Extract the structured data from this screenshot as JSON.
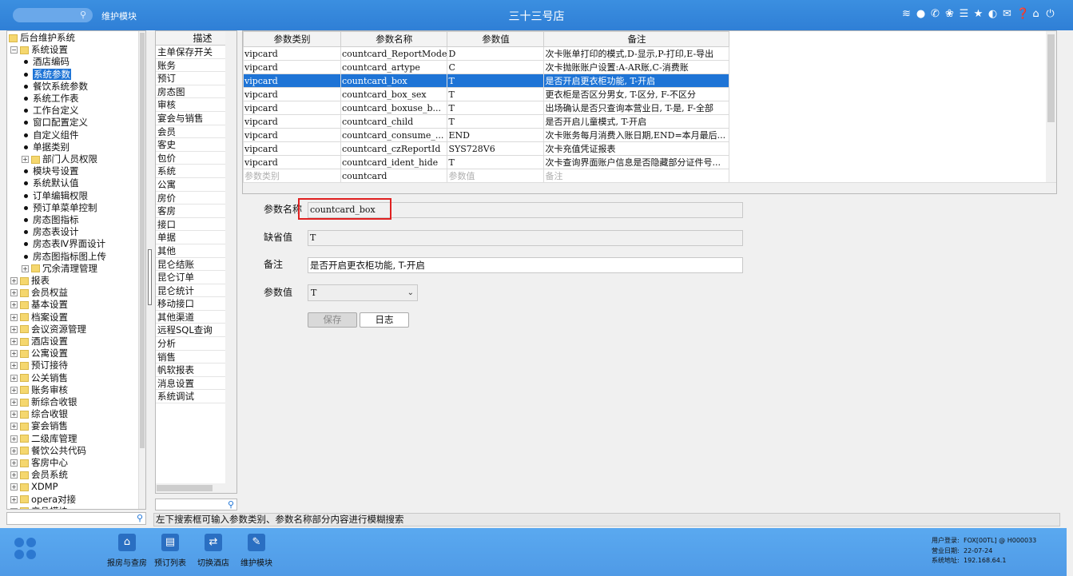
{
  "topbar": {
    "search_placeholder": "",
    "module": "维护模块",
    "title": "三十三号店",
    "icons": [
      "wifi-icon",
      "chat-icon",
      "phone-icon",
      "palette-icon",
      "menu-icon",
      "star-icon",
      "contrast-icon",
      "mail-icon",
      "help-icon",
      "home-icon",
      "power-icon"
    ]
  },
  "tree": {
    "nodes": [
      {
        "label": "后台维护系统",
        "kind": "root",
        "depth": 0
      },
      {
        "label": "系统设置",
        "kind": "folder-open",
        "depth": 1
      },
      {
        "label": "酒店编码",
        "kind": "leaf",
        "depth": 2
      },
      {
        "label": "系统参数",
        "kind": "leaf",
        "depth": 2,
        "selected": true
      },
      {
        "label": "餐饮系统参数",
        "kind": "leaf",
        "depth": 2
      },
      {
        "label": "系统工作表",
        "kind": "leaf",
        "depth": 2
      },
      {
        "label": "工作台定义",
        "kind": "leaf",
        "depth": 2
      },
      {
        "label": "窗口配置定义",
        "kind": "leaf",
        "depth": 2
      },
      {
        "label": "自定义组件",
        "kind": "leaf",
        "depth": 2
      },
      {
        "label": "单据类别",
        "kind": "leaf",
        "depth": 2
      },
      {
        "label": "部门人员权限",
        "kind": "folder",
        "depth": 2
      },
      {
        "label": "模块号设置",
        "kind": "leaf",
        "depth": 2
      },
      {
        "label": "系统默认值",
        "kind": "leaf",
        "depth": 2
      },
      {
        "label": "订单编辑权限",
        "kind": "leaf",
        "depth": 2
      },
      {
        "label": "预订单菜单控制",
        "kind": "leaf",
        "depth": 2
      },
      {
        "label": "房态图指标",
        "kind": "leaf",
        "depth": 2
      },
      {
        "label": "房态表设计",
        "kind": "leaf",
        "depth": 2
      },
      {
        "label": "房态表Ⅳ界面设计",
        "kind": "leaf",
        "depth": 2
      },
      {
        "label": "房态图指标图上传",
        "kind": "leaf",
        "depth": 2
      },
      {
        "label": "冗余清理管理",
        "kind": "folder",
        "depth": 2
      },
      {
        "label": "报表",
        "kind": "folder",
        "depth": 1
      },
      {
        "label": "会员权益",
        "kind": "folder",
        "depth": 1
      },
      {
        "label": "基本设置",
        "kind": "folder",
        "depth": 1
      },
      {
        "label": "档案设置",
        "kind": "folder",
        "depth": 1
      },
      {
        "label": "会议资源管理",
        "kind": "folder",
        "depth": 1
      },
      {
        "label": "酒店设置",
        "kind": "folder",
        "depth": 1
      },
      {
        "label": "公寓设置",
        "kind": "folder",
        "depth": 1
      },
      {
        "label": "预订接待",
        "kind": "folder",
        "depth": 1
      },
      {
        "label": "公关销售",
        "kind": "folder",
        "depth": 1
      },
      {
        "label": "账务审核",
        "kind": "folder",
        "depth": 1
      },
      {
        "label": "新综合收银",
        "kind": "folder",
        "depth": 1
      },
      {
        "label": "综合收银",
        "kind": "folder",
        "depth": 1
      },
      {
        "label": "宴会销售",
        "kind": "folder",
        "depth": 1
      },
      {
        "label": "二级库管理",
        "kind": "folder",
        "depth": 1
      },
      {
        "label": "餐饮公共代码",
        "kind": "folder",
        "depth": 1
      },
      {
        "label": "客房中心",
        "kind": "folder",
        "depth": 1
      },
      {
        "label": "会员系统",
        "kind": "folder",
        "depth": 1
      },
      {
        "label": "XDMP",
        "kind": "folder",
        "depth": 1
      },
      {
        "label": "opera对接",
        "kind": "folder",
        "depth": 1
      },
      {
        "label": "产品模块",
        "kind": "folder",
        "depth": 1
      }
    ]
  },
  "desc": {
    "header": "描述",
    "items": [
      "主单保存开关",
      "账务",
      "预订",
      "房态图",
      "审核",
      "宴会与销售",
      "会员",
      "客史",
      "包价",
      "系统",
      "公寓",
      "房价",
      "客房",
      "接口",
      "单据",
      "其他",
      "昆仑结账",
      "昆仑订单",
      "昆仑统计",
      "移动接口",
      "其他渠道",
      "远程SQL查询",
      "分析",
      "销售",
      "帆软报表",
      "消息设置",
      "系统调试"
    ]
  },
  "grid": {
    "columns": [
      "参数类别",
      "参数名称",
      "参数值",
      "备注"
    ],
    "rows": [
      [
        "vipcard",
        "countcard_ReportMode",
        "D",
        "次卡账单打印的模式,D-显示,P-打印,E-导出"
      ],
      [
        "vipcard",
        "countcard_artype",
        "C",
        "次卡抛账账户设置:A-AR账,C-消费账"
      ],
      [
        "vipcard",
        "countcard_box",
        "T",
        "是否开启更衣柜功能, T-开启"
      ],
      [
        "vipcard",
        "countcard_box_sex",
        "T",
        "更衣柜是否区分男女, T-区分, F-不区分"
      ],
      [
        "vipcard",
        "countcard_boxuse_b...",
        "T",
        "出场确认是否只查询本营业日, T-是, F-全部"
      ],
      [
        "vipcard",
        "countcard_child",
        "T",
        "是否开启儿童模式, T-开启"
      ],
      [
        "vipcard",
        "countcard_consume_...",
        "END",
        "次卡账务每月消费入账日期,END=本月最后..."
      ],
      [
        "vipcard",
        "countcard_czReportId",
        "SYS728V6",
        "次卡充值凭证报表"
      ],
      [
        "vipcard",
        "countcard_ident_hide",
        "T",
        "次卡查询界面账户信息是否隐藏部分证件号..."
      ]
    ],
    "selected_row": 2,
    "edit_row": [
      "参数类别",
      "countcard",
      "参数值",
      "备注"
    ]
  },
  "form": {
    "name_label": "参数名称",
    "name_value": "countcard_box",
    "default_label": "缺省值",
    "default_value": "T",
    "remark_label": "备注",
    "remark_value": "是否开启更衣柜功能, T-开启",
    "value_label": "参数值",
    "value_selected": "T",
    "save_label": "保存",
    "log_label": "日志"
  },
  "hint": "左下搜索框可输入参数类别、参数名称部分内容进行模糊搜索",
  "dock": [
    {
      "label": "报房与查房",
      "icon": "home-icon"
    },
    {
      "label": "预订列表",
      "icon": "list-icon"
    },
    {
      "label": "切换酒店",
      "icon": "switch-icon"
    },
    {
      "label": "维护模块",
      "icon": "wrench-icon"
    }
  ],
  "status": {
    "user_label": "用户登录:",
    "user_value": "FOX[00TL] @ H000033",
    "date_label": "营业日期:",
    "date_value": "22-07-24",
    "addr_label": "系统地址:",
    "addr_value": "192.168.64.1"
  }
}
